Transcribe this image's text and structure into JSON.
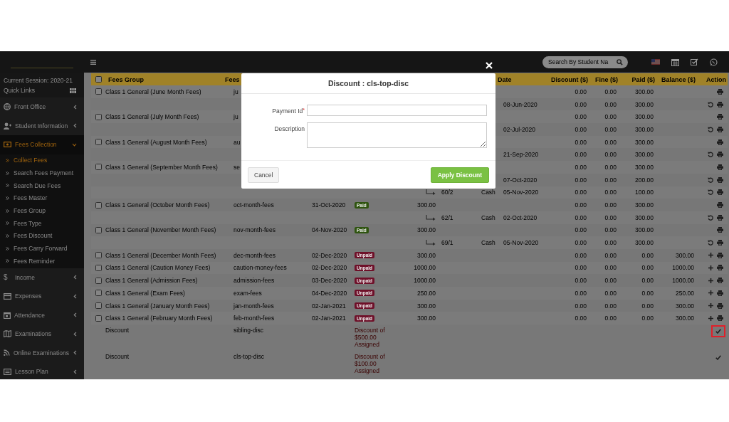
{
  "topbar": {
    "search": {
      "placeholder": "Search By Student Na"
    }
  },
  "sidebar": {
    "session": "Current Session: 2020-21",
    "quick_links": "Quick Links",
    "items": [
      {
        "label": "Front Office",
        "expanded": false,
        "selected": false
      },
      {
        "label": "Student Information",
        "expanded": false,
        "selected": false
      },
      {
        "label": "Fees Collection",
        "expanded": true,
        "selected": true,
        "children": [
          {
            "label": "Collect Fees",
            "selected": true
          },
          {
            "label": "Search Fees Payment",
            "selected": false
          },
          {
            "label": "Search Due Fees",
            "selected": false
          },
          {
            "label": "Fees Master",
            "selected": false
          },
          {
            "label": "Fees Group",
            "selected": false
          },
          {
            "label": "Fees Type",
            "selected": false
          },
          {
            "label": "Fees Discount",
            "selected": false
          },
          {
            "label": "Fees Carry Forward",
            "selected": false
          },
          {
            "label": "Fees Reminder",
            "selected": false
          }
        ]
      },
      {
        "label": "Income",
        "glyph": "$",
        "expanded": false,
        "selected": false
      },
      {
        "label": "Expenses",
        "expanded": false,
        "selected": false
      },
      {
        "label": "Attendance",
        "expanded": false,
        "selected": false
      },
      {
        "label": "Examinations",
        "expanded": false,
        "selected": false
      },
      {
        "label": "Online Examinations",
        "expanded": false,
        "selected": false
      },
      {
        "label": "Lesson Plan",
        "expanded": false,
        "selected": false
      }
    ]
  },
  "table": {
    "header_checkbox": {
      "checked": false
    },
    "columns": [
      "Fees Group",
      "Fees",
      "Date",
      "Discount ($)",
      "Fine ($)",
      "Paid ($)",
      "Balance ($)",
      "Action"
    ],
    "rows": [
      {
        "kind": "fee_paid",
        "checked": false,
        "group": "Class 1 General (June Month Fees)",
        "code": "ju",
        "discount": "0.00",
        "fine": "0.00",
        "paid": "300.00"
      },
      {
        "kind": "payment",
        "date": "08-Jun-2020",
        "discount": "0.00",
        "fine": "0.00",
        "paid": "300.00"
      },
      {
        "kind": "fee_paid",
        "checked": false,
        "group": "Class 1 General (July Month Fees)",
        "code": "ju",
        "discount": "0.00",
        "fine": "0.00",
        "paid": "300.00"
      },
      {
        "kind": "payment",
        "date": "02-Jul-2020",
        "discount": "0.00",
        "fine": "0.00",
        "paid": "300.00"
      },
      {
        "kind": "fee_paid",
        "checked": false,
        "group": "Class 1 General (August Month Fees)",
        "code": "au",
        "discount": "0.00",
        "fine": "0.00",
        "paid": "300.00"
      },
      {
        "kind": "payment",
        "date": "21-Sep-2020",
        "discount": "0.00",
        "fine": "0.00",
        "paid": "300.00"
      },
      {
        "kind": "fee_paid",
        "checked": false,
        "group": "Class 1 General (September Month Fees)",
        "code": "se",
        "discount": "0.00",
        "fine": "0.00",
        "paid": "300.00"
      },
      {
        "kind": "payment",
        "date": "07-Oct-2020",
        "discount": "0.00",
        "fine": "0.00",
        "paid": "200.00"
      },
      {
        "kind": "payment",
        "payment_id": "60/2",
        "mode": "Cash",
        "date": "05-Nov-2020",
        "discount": "0.00",
        "fine": "0.00",
        "paid": "100.00"
      },
      {
        "kind": "fee_paid",
        "checked": false,
        "group": "Class 1 General (October Month Fees)",
        "code": "oct-month-fees",
        "due_date": "31-Oct-2020",
        "status": "Paid",
        "amount": "300.00",
        "discount": "0.00",
        "fine": "0.00",
        "paid": "300.00"
      },
      {
        "kind": "payment",
        "payment_id": "62/1",
        "mode": "Cash",
        "date": "02-Oct-2020",
        "discount": "0.00",
        "fine": "0.00",
        "paid": "300.00"
      },
      {
        "kind": "fee_paid",
        "checked": false,
        "group": "Class 1 General (November Month Fees)",
        "code": "nov-month-fees",
        "due_date": "04-Nov-2020",
        "status": "Paid",
        "amount": "300.00",
        "discount": "0.00",
        "fine": "0.00",
        "paid": "300.00"
      },
      {
        "kind": "payment",
        "payment_id": "69/1",
        "mode": "Cash",
        "date": "05-Nov-2020",
        "discount": "0.00",
        "fine": "0.00",
        "paid": "300.00"
      },
      {
        "kind": "fee_unpaid",
        "checked": false,
        "group": "Class 1 General (December Month Fees)",
        "code": "dec-month-fees",
        "due_date": "02-Dec-2020",
        "status": "Unpaid",
        "amount": "300.00",
        "discount": "0.00",
        "fine": "0.00",
        "paid": "0.00",
        "balance": "300.00"
      },
      {
        "kind": "fee_unpaid",
        "checked": false,
        "group": "Class 1 General (Caution Money Fees)",
        "code": "caution-money-fees",
        "due_date": "02-Dec-2020",
        "status": "Unpaid",
        "amount": "1000.00",
        "discount": "0.00",
        "fine": "0.00",
        "paid": "0.00",
        "balance": "1000.00"
      },
      {
        "kind": "fee_unpaid",
        "checked": false,
        "group": "Class 1 General (Admission Fees)",
        "code": "admission-fees",
        "due_date": "03-Dec-2020",
        "status": "Unpaid",
        "amount": "1000.00",
        "discount": "0.00",
        "fine": "0.00",
        "paid": "0.00",
        "balance": "1000.00"
      },
      {
        "kind": "fee_unpaid",
        "checked": false,
        "group": "Class 1 General (Exam Fees)",
        "code": "exam-fees",
        "due_date": "04-Dec-2020",
        "status": "Unpaid",
        "amount": "250.00",
        "discount": "0.00",
        "fine": "0.00",
        "paid": "0.00",
        "balance": "250.00"
      },
      {
        "kind": "fee_unpaid",
        "checked": false,
        "group": "Class 1 General (January Month Fees)",
        "code": "jan-month-fees",
        "due_date": "02-Jan-2021",
        "status": "Unpaid",
        "amount": "300.00",
        "discount": "0.00",
        "fine": "0.00",
        "paid": "0.00",
        "balance": "300.00"
      },
      {
        "kind": "fee_unpaid",
        "checked": false,
        "group": "Class 1 General (February Month Fees)",
        "code": "feb-month-fees",
        "due_date": "02-Jan-2021",
        "status": "Unpaid",
        "amount": "300.00",
        "discount": "0.00",
        "fine": "0.00",
        "paid": "0.00",
        "balance": "300.00"
      },
      {
        "kind": "discount",
        "group": "Discount",
        "code": "sibling-disc",
        "note": "Discount of $500.00 Assigned",
        "highlighted": true
      },
      {
        "kind": "discount",
        "group": "Discount",
        "code": "cls-top-disc",
        "note": "Discount of $100.00 Assigned",
        "highlighted": false
      }
    ]
  },
  "modal": {
    "title": "Discount : cls-top-disc",
    "fields": [
      {
        "kind": "input",
        "label": "Payment Id",
        "required_mark": "*"
      },
      {
        "kind": "textarea",
        "label": "Description"
      }
    ],
    "buttons": [
      {
        "kind": "secondary",
        "label": "Cancel"
      },
      {
        "kind": "primary",
        "label": "Apply Discount"
      }
    ]
  }
}
